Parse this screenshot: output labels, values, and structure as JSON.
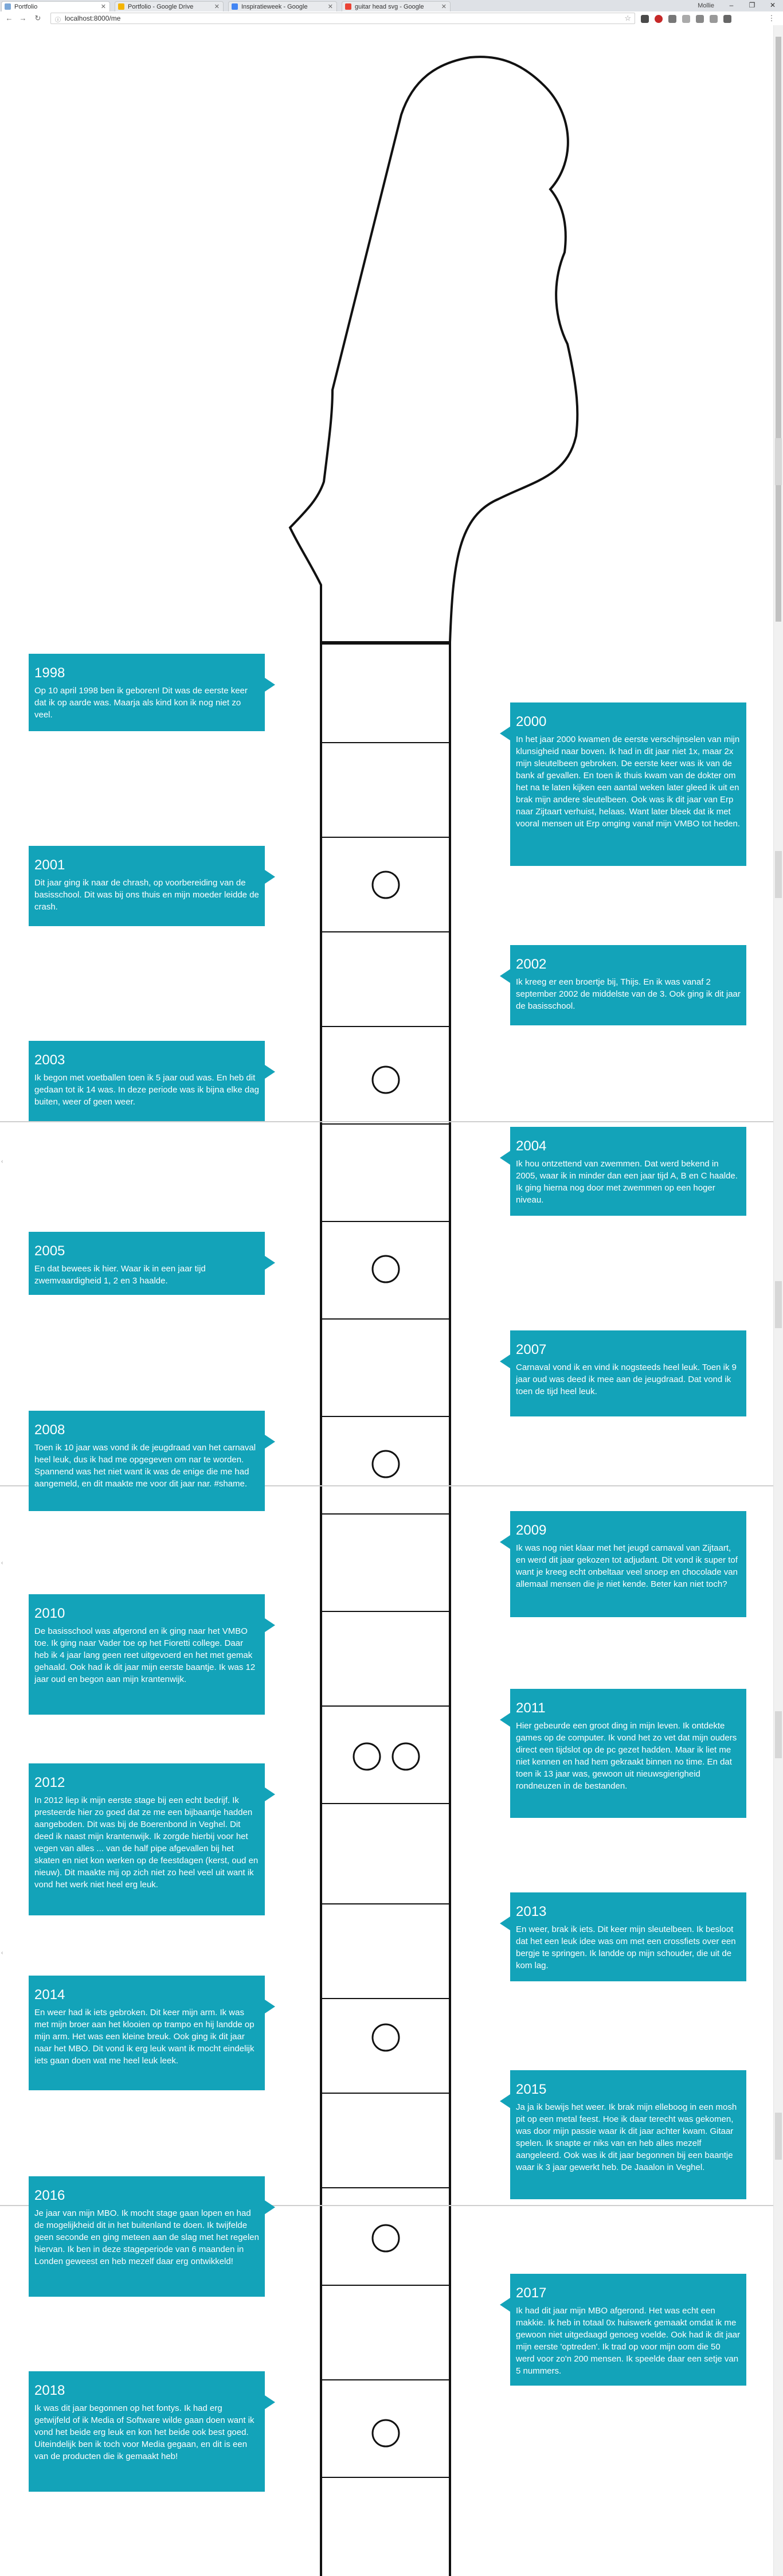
{
  "browser": {
    "tabs": [
      "Portfolio",
      "Portfolio - Google Drive",
      "Inspiratieweek - Google",
      "guitar head svg - Google"
    ],
    "profile": "Mollie",
    "url": "localhost:8000/me"
  },
  "timeline": [
    {
      "year": "1998",
      "side": "left",
      "text": "Op 10 april 1998 ben ik geboren! Dit was de eerste keer dat ik op aarde was. Maarja als kind kon ik nog niet zo veel."
    },
    {
      "year": "2000",
      "side": "right",
      "text": "In het jaar 2000 kwamen de eerste verschijnselen van mijn klunsigheid naar boven. Ik had in dit jaar niet 1x, maar 2x mijn sleutelbeen gebroken. De eerste keer was ik van de bank af gevallen. En toen ik thuis kwam van de dokter om het na te laten kijken een aantal weken later gleed ik uit en brak mijn andere sleutelbeen. Ook was ik dit jaar van Erp naar Zijtaart verhuist, helaas. Want later bleek dat ik met vooral mensen uit Erp omging vanaf mijn VMBO tot heden."
    },
    {
      "year": "2001",
      "side": "left",
      "text": "Dit jaar ging ik naar de chrash, op voorbereiding van de basisschool. Dit was bij ons thuis en mijn moeder leidde de crash."
    },
    {
      "year": "2002",
      "side": "right",
      "text": "Ik kreeg er een broertje bij, Thijs. En ik was vanaf 2 september 2002 de middelste van de 3. Ook ging ik dit jaar de basisschool."
    },
    {
      "year": "2003",
      "side": "left",
      "text": "Ik begon met voetballen toen ik 5 jaar oud was. En heb dit gedaan tot ik 14 was. In deze periode was ik bijna elke dag buiten, weer of geen weer."
    },
    {
      "year": "2004",
      "side": "right",
      "text": "Ik hou ontzettend van zwemmen. Dat werd bekend in 2005, waar ik in minder dan een jaar tijd A, B en C haalde. Ik ging hierna nog door met zwemmen op een hoger niveau."
    },
    {
      "year": "2005",
      "side": "left",
      "text": "En dat bewees ik hier. Waar ik in een jaar tijd zwemvaardigheid 1, 2 en 3 haalde."
    },
    {
      "year": "2007",
      "side": "right",
      "text": "Carnaval vond ik en vind ik nogsteeds heel leuk. Toen ik 9 jaar oud was deed ik mee aan de jeugdraad. Dat vond ik toen de tijd heel leuk."
    },
    {
      "year": "2008",
      "side": "left",
      "text": "Toen ik 10 jaar was vond ik de jeugdraad van het carnaval heel leuk, dus ik had me opgegeven om nar te worden. Spannend was het niet want ik was de enige die me had aangemeld, en dit maakte me voor dit jaar nar. #shame."
    },
    {
      "year": "2009",
      "side": "right",
      "text": "Ik was nog niet klaar met het jeugd carnaval van Zijtaart, en werd dit jaar gekozen tot adjudant. Dit vond ik super tof want je kreeg echt onbeltaar veel snoep en chocolade van allemaal mensen die je niet kende. Beter kan niet toch?"
    },
    {
      "year": "2010",
      "side": "left",
      "text": "De basisschool was afgerond en ik ging naar het VMBO toe. Ik ging naar Vader toe op het Fioretti college. Daar heb ik 4 jaar lang geen reet uitgevoerd en het met gemak gehaald. Ook had ik dit jaar mijn eerste baantje. Ik was 12 jaar oud en begon aan mijn krantenwijk."
    },
    {
      "year": "2011",
      "side": "right",
      "text": "Hier gebeurde een groot ding in mijn leven. Ik ontdekte games op de computer. Ik vond het zo vet dat mijn ouders direct een tijdslot op de pc gezet hadden. Maar ik liet me niet kennen en had hem gekraakt binnen no time. En dat toen ik 13 jaar was, gewoon uit nieuwsgierigheid rondneuzen in de bestanden."
    },
    {
      "year": "2012",
      "side": "left",
      "text": "In 2012 liep ik mijn eerste stage bij een echt bedrijf. Ik presteerde hier zo goed dat ze me een bijbaantje hadden aangeboden. Dit was bij de Boerenbond in Veghel. Dit deed ik naast mijn krantenwijk. Ik zorgde hierbij voor het vegen van alles ... van de half pipe afgevallen bij het skaten en niet kon werken op de feestdagen (kerst, oud en nieuw). Dit maakte mij op zich niet zo heel veel uit want ik vond het werk niet heel erg leuk."
    },
    {
      "year": "2013",
      "side": "right",
      "text": "En weer, brak ik iets. Dit keer mijn sleutelbeen. Ik besloot dat het een leuk idee was om met een crossfiets over een bergje te springen. Ik landde op mijn schouder, die uit de kom lag."
    },
    {
      "year": "2014",
      "side": "left",
      "text": "En weer had ik iets gebroken. Dit keer mijn arm. Ik was met mijn broer aan het klooien op trampo en hij landde op mijn arm. Het was een kleine breuk. Ook ging ik dit jaar naar het MBO. Dit vond ik erg leuk want ik mocht eindelijk iets gaan doen wat me heel leuk leek."
    },
    {
      "year": "2015",
      "side": "right",
      "text": "Ja ja ik bewijs het weer. Ik brak mijn elleboog in een mosh pit op een metal feest. Hoe ik daar terecht was gekomen, was door mijn passie waar ik dit jaar achter kwam. Gitaar spelen. Ik snapte er niks van en heb alles mezelf aangeleerd. Ook was ik dit jaar begonnen bij een baantje waar ik 3 jaar gewerkt heb. De Jaaalon in Veghel."
    },
    {
      "year": "2016",
      "side": "left",
      "text": "Je jaar van mijn MBO. Ik mocht stage gaan lopen en had de mogelijkheid dit in het buitenland te doen. Ik twijfelde geen seconde en ging meteen aan de slag met het regelen hiervan. Ik ben in deze stageperiode van 6 maanden in Londen geweest en heb mezelf daar erg ontwikkeld!"
    },
    {
      "year": "2017",
      "side": "right",
      "text": "Ik had dit jaar mijn MBO afgerond. Het was echt een makkie. Ik heb in totaal 0x huiswerk gemaakt omdat ik me gewoon niet uitgedaagd genoeg voelde. Ook had ik dit jaar mijn eerste 'optreden'. Ik trad op voor mijn oom die 50 werd voor zo'n 200 mensen. Ik speelde daar een setje van 5 nummers."
    },
    {
      "year": "2018",
      "side": "left",
      "text": "Ik was dit jaar begonnen op het fontys. Ik had erg getwijfeld of ik Media of Software wilde gaan doen want ik vond het beide erg leuk en kon het beide ook best goed. Uiteindelijk ben ik toch voor Media gegaan, en dit is een van de producten die ik gemaakt heb!"
    }
  ]
}
